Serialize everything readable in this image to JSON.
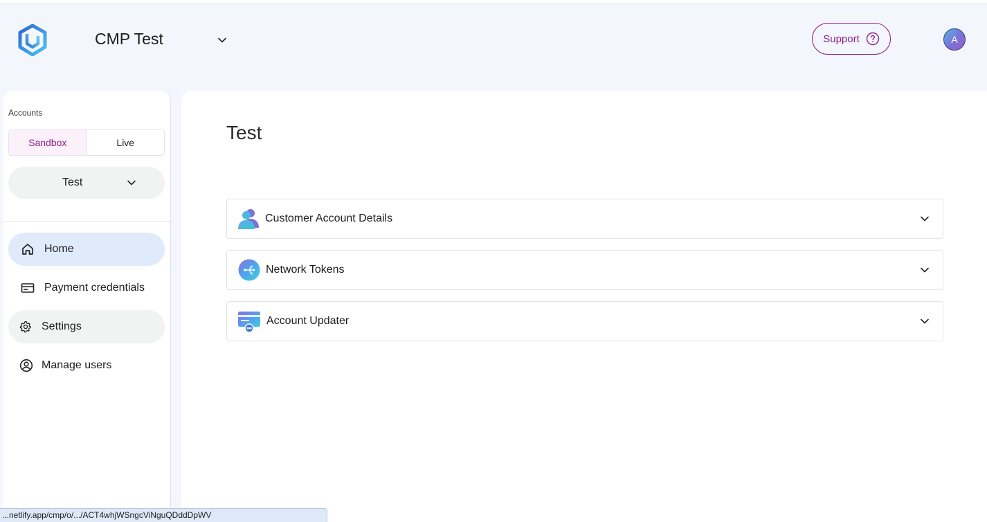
{
  "header": {
    "org_name": "CMP Test",
    "support_label": "Support",
    "avatar_initial": "A"
  },
  "sidebar": {
    "accounts_label": "Accounts",
    "environments": [
      {
        "label": "Sandbox",
        "active": true
      },
      {
        "label": "Live",
        "active": false
      }
    ],
    "selected_account": "Test",
    "nav": [
      {
        "label": "Home",
        "icon": "home-icon",
        "active": true
      },
      {
        "label": "Payment credentials",
        "icon": "credit-card-icon",
        "active": false
      },
      {
        "label": "Settings",
        "icon": "gear-icon",
        "active": false
      },
      {
        "label": "Manage users",
        "icon": "user-circle-icon",
        "active": false
      }
    ]
  },
  "main": {
    "title": "Test",
    "panels": [
      {
        "label": "Customer Account Details",
        "icon": "customer-account-icon"
      },
      {
        "label": "Network Tokens",
        "icon": "network-token-icon"
      },
      {
        "label": "Account Updater",
        "icon": "account-updater-icon"
      }
    ]
  },
  "status_bar": {
    "url": "...netlify.app/cmp/o/.../ACT4whjWSngcViNguQDddDpWV"
  },
  "colors": {
    "accent": "#8e1f8c",
    "active_nav": "#dfeafb",
    "page_bg": "#f3f6fc"
  }
}
